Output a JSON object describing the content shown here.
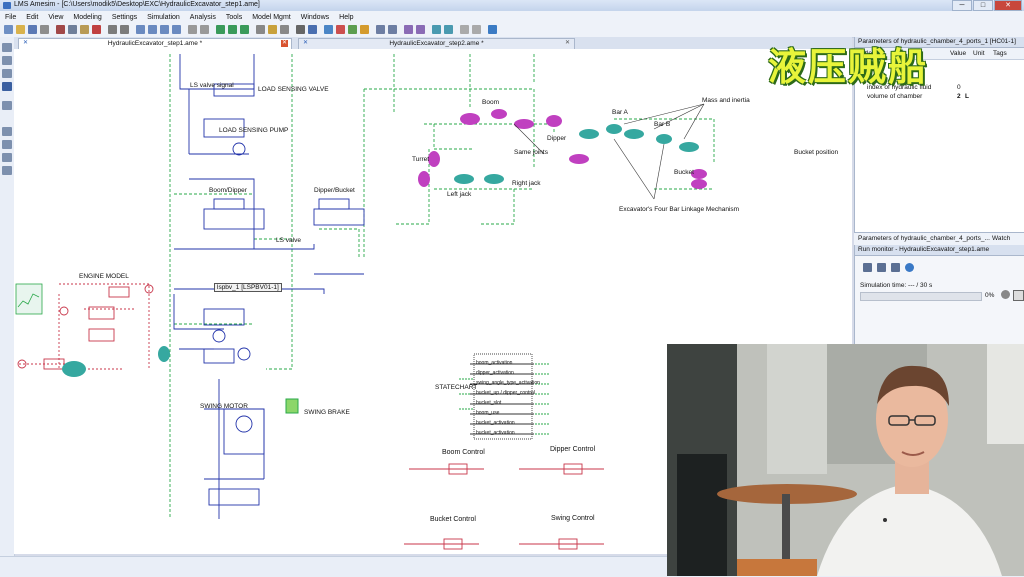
{
  "window": {
    "title": "LMS Amesim - [C:\\Users\\modik5\\Desktop\\EXC\\HydraulicExcavator_step1.ame]",
    "minimize": "─",
    "maximize": "□",
    "close": "✕"
  },
  "menu": [
    "File",
    "Edit",
    "View",
    "Modeling",
    "Settings",
    "Simulation",
    "Analysis",
    "Tools",
    "Model Mgmt",
    "Windows",
    "Help"
  ],
  "tabs": [
    {
      "label": "HydraulicExcavator_step1.ame *"
    },
    {
      "label": "HydraulicExcavator_step2.ame *"
    }
  ],
  "canvas": {
    "labels": {
      "ls_valve_signal": "LS valve signal",
      "ls_sensing_valve": "LOAD SENSING VALVE",
      "ls_pump": "LOAD SENSING PUMP",
      "boom_dipper": "Boom/Dipper",
      "dipper_bucket": "Dipper/Bucket",
      "ls_valve": "LS valve",
      "engine_model": "ENGINE MODEL",
      "swing_motor": "SWING MOTOR",
      "swing_brake": "SWING BRAKE",
      "tooltip": "lspbv_1 [LSPBV01-1]",
      "boom": "Boom",
      "dipper": "Dipper",
      "bucket": "Bucket",
      "turret": "Turret",
      "bar_a": "Bar A",
      "bar_b": "Bar B",
      "left_jack": "Left jack",
      "right_jack": "Right jack",
      "same_joints": "Same joints",
      "mass_inertia": "Mass and inertia",
      "four_bar": "Excavator's Four Bar Linkage Mechanism",
      "bucket_position": "Bucket position",
      "state_chart": "STATECHART",
      "boom_control": "Boom Control",
      "dipper_control": "Dipper Control",
      "bucket_control": "Bucket Control",
      "swing_control": "Swing Control",
      "statechart_rows": [
        "boom_activation",
        "dipper_activation",
        "swing_angle_type_activation",
        "bucket_up / dipper_control",
        "bucket_slot",
        "boom_use",
        "bucket_activation",
        "bucket_activation"
      ]
    }
  },
  "params_panel": {
    "title": "Parameters of hydraulic_chamber_4_ports_1 [HC01-1]",
    "tabs": [
      "Title",
      "Value",
      "Unit",
      "Tags"
    ],
    "rows": [
      {
        "name": "index of hydraulic fluid",
        "value": "0",
        "unit": ""
      },
      {
        "name": "volume of chamber",
        "value": "2",
        "unit": "L"
      }
    ],
    "bottom_tab": "Parameters of hydraulic_chamber_4_ports_...",
    "watch_tab": "Watch"
  },
  "run_monitor": {
    "title": "Run monitor - HydraulicExcavator_step1.ame",
    "sim_time": "Simulation time: --- / 30 s",
    "progress": 0,
    "progress_label": "0%"
  },
  "overlay_logo": "液压贼船",
  "colors": {
    "hydraulic": "#2233aa",
    "signal": "#2aa84a",
    "mechanical": "#c8364a",
    "magenta": "#c040c0",
    "cyan": "#36a8a0"
  }
}
